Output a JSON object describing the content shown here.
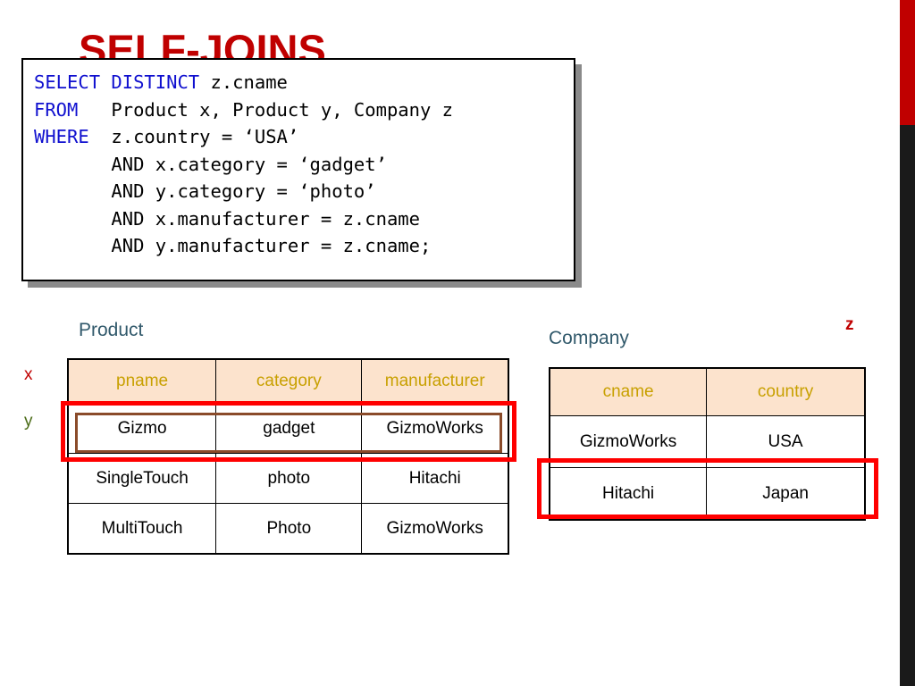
{
  "slide": {
    "title": "SELF-JOINS"
  },
  "sql": {
    "lines": [
      {
        "keyword": "SELECT DISTINCT",
        "rest": " z.cname"
      },
      {
        "keyword": "FROM",
        "rest": "   Product x, Product y, Company z"
      },
      {
        "keyword": "WHERE",
        "rest": "  z.country = ‘USA’"
      },
      {
        "keyword": "",
        "rest": "       AND x.category = ‘gadget’"
      },
      {
        "keyword": "",
        "rest": "       AND y.category = ‘photo’"
      },
      {
        "keyword": "",
        "rest": "       AND x.manufacturer = z.cname"
      },
      {
        "keyword": "",
        "rest": "       AND y.manufacturer = z.cname;"
      }
    ]
  },
  "product": {
    "caption": "Product",
    "headers": [
      "pname",
      "category",
      "manufacturer"
    ],
    "rows": [
      [
        "Gizmo",
        "gadget",
        "GizmoWorks"
      ],
      [
        "SingleTouch",
        "photo",
        "Hitachi"
      ],
      [
        "MultiTouch",
        "Photo",
        "GizmoWorks"
      ]
    ]
  },
  "company": {
    "caption": "Company",
    "headers": [
      "cname",
      "country"
    ],
    "rows": [
      [
        "GizmoWorks",
        "USA"
      ],
      [
        "Hitachi",
        "Japan"
      ]
    ]
  },
  "aliases": {
    "x": "x",
    "y": "y",
    "z": "z"
  },
  "colors": {
    "title_red": "#c00000",
    "keyword_blue": "#1010cf",
    "header_bg": "#fce3cd",
    "header_text": "#c8a000",
    "caption": "#31596b",
    "highlight_red": "#ff0000",
    "highlight_brown": "#8a4b2a",
    "alias_y_green": "#4a6b16"
  }
}
